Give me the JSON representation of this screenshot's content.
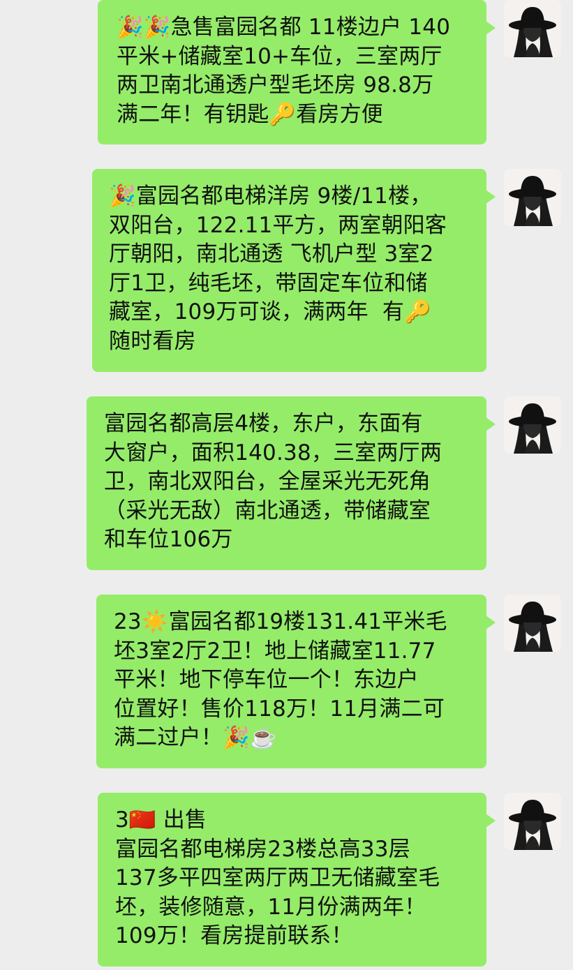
{
  "messages": [
    {
      "text": "🎉🎉急售富园名都 11楼边户 140\n平米+储藏室10+车位，三室两厅\n两卫南北通透户型毛坯房 98.8万\n满二年！有钥匙🔑看房方便",
      "avatar_icon": "hat-woman-avatar"
    },
    {
      "text": "🎉富园名都电梯洋房 9楼/11楼，\n双阳台，122.11平方，两室朝阳客\n厅朝阳，南北通透 飞机户型 3室2\n厅1卫，纯毛坯，带固定车位和储\n藏室，109万可谈，满两年  有🔑\n随时看房",
      "avatar_icon": "hat-woman-avatar"
    },
    {
      "text": "富园名都高层4楼，东户，东面有\n大窗户，面积140.38，三室两厅两\n卫，南北双阳台，全屋采光无死角\n（采光无敌）南北通透，带储藏室\n和车位106万",
      "avatar_icon": "hat-woman-avatar"
    },
    {
      "text": "23☀️富园名都19楼131.41平米毛\n坯3室2厅2卫！地上储藏室11.77\n平米！地下停车位一个！东边户\n位置好！售价118万！11月满二可\n满二过户！🎉☕️",
      "avatar_icon": "hat-woman-avatar"
    },
    {
      "text": "3🇨🇳 出售\n富园名都电梯房23楼总高33层\n137多平四室两厅两卫无储藏室毛\n坯，装修随意，11月份满两年！\n109万！看房提前联系！",
      "avatar_icon": "hat-woman-avatar"
    }
  ],
  "colors": {
    "background": "#ededed",
    "bubble": "#95ec69",
    "text": "#111111"
  }
}
